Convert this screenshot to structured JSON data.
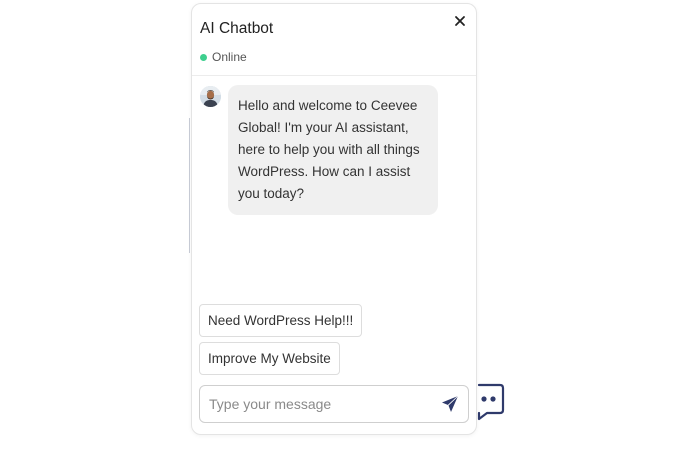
{
  "chat": {
    "title": "AI Chatbot",
    "status": "Online",
    "close_icon": "close-icon",
    "status_color": "#3ecf8e"
  },
  "messages": [
    {
      "sender": "bot",
      "avatar": "bot-avatar",
      "text": "Hello and welcome to Ceevee Global! I'm your AI assistant, here to help you with all things WordPress. How can I assist you today?"
    }
  ],
  "quick_replies": [
    {
      "label": "Need WordPress Help!!!"
    },
    {
      "label": "Improve My Website"
    }
  ],
  "composer": {
    "placeholder": "Type your message",
    "value": "",
    "send_icon": "send-icon"
  },
  "launcher": {
    "icon": "chat-bubble-icon",
    "accent": "#2f3a6b"
  }
}
